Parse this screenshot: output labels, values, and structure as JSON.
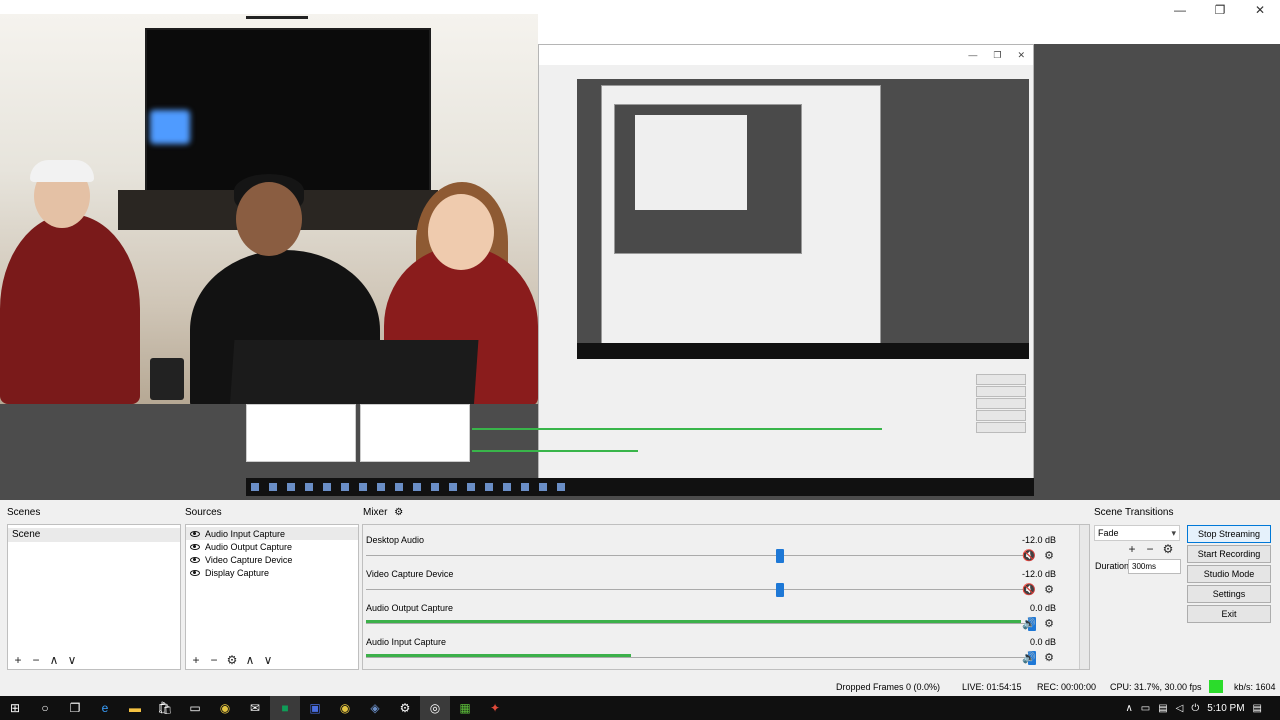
{
  "window": {
    "minimize": "—",
    "maximize": "❐",
    "close": "✕"
  },
  "docks": {
    "scenes": {
      "title": "Scenes",
      "items": [
        "Scene"
      ]
    },
    "sources": {
      "title": "Sources",
      "items": [
        "Audio Input Capture",
        "Audio Output Capture",
        "Video Capture Device",
        "Display Capture"
      ]
    },
    "mixer": {
      "title": "Mixer"
    },
    "transitions": {
      "title": "Scene Transitions",
      "selected": "Fade",
      "duration_label": "Duration",
      "duration_value": "300ms"
    }
  },
  "mixer_channels": [
    {
      "name": "Desktop Audio",
      "db": "-12.0 dB",
      "muted": true,
      "fader": 0.62,
      "level": 0.0
    },
    {
      "name": "Video Capture Device",
      "db": "-12.0 dB",
      "muted": true,
      "fader": 0.62,
      "level": 0.0
    },
    {
      "name": "Audio Output Capture",
      "db": "0.0 dB",
      "muted": false,
      "fader": 1.0,
      "level": 0.99
    },
    {
      "name": "Audio Input Capture",
      "db": "0.0 dB",
      "muted": false,
      "fader": 1.0,
      "level": 0.4
    }
  ],
  "controls": {
    "stop_streaming": "Stop Streaming",
    "start_recording": "Start Recording",
    "studio_mode": "Studio Mode",
    "settings": "Settings",
    "exit": "Exit"
  },
  "status": {
    "dropped": "Dropped Frames 0 (0.0%)",
    "live": "LIVE: 01:54:15",
    "rec": "REC: 00:00:00",
    "cpu": "CPU: 31.7%, 30.00 fps",
    "kbs": "kb/s: 1604",
    "indicator_color": "#2bdc2b"
  },
  "taskbar": {
    "icons": [
      "windows-logo-icon",
      "cortana-icon",
      "task-view-icon",
      "edge-icon",
      "file-explorer-icon",
      "store-icon",
      "terminal-icon",
      "chrome-icon",
      "mail-icon",
      "hangouts-icon",
      "app-icon",
      "chrome-icon",
      "app-icon",
      "settings-icon",
      "obs-icon",
      "app-icon",
      "app-icon"
    ],
    "time": "5:10 PM"
  },
  "colors": {
    "accent": "#1e78d6",
    "meter": "#3cb04a",
    "mute": "#c41b1b"
  }
}
